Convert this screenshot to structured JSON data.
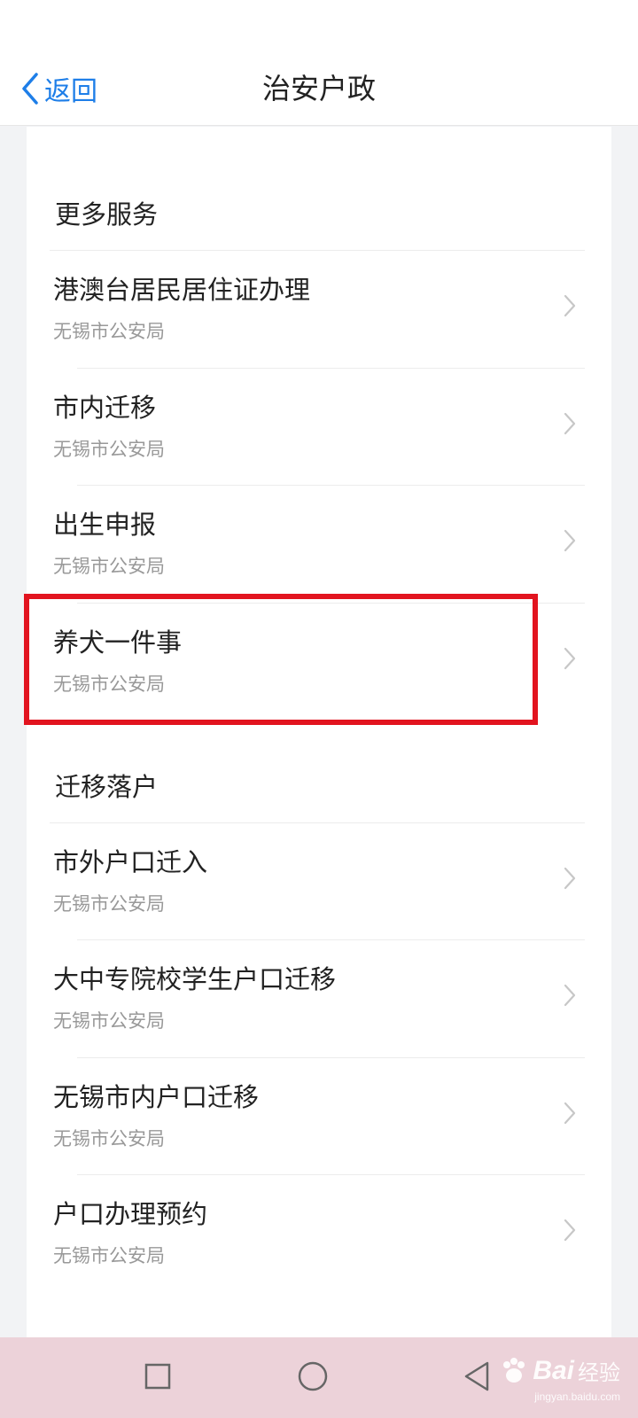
{
  "header": {
    "back_label": "返回",
    "title": "治安户政"
  },
  "sections": [
    {
      "title": "更多服务",
      "items": [
        {
          "title": "港澳台居民居住证办理",
          "subtitle": "无锡市公安局"
        },
        {
          "title": "市内迁移",
          "subtitle": "无锡市公安局"
        },
        {
          "title": "出生申报",
          "subtitle": "无锡市公安局"
        },
        {
          "title": "养犬一件事",
          "subtitle": "无锡市公安局"
        }
      ]
    },
    {
      "title": "迁移落户",
      "items": [
        {
          "title": "市外户口迁入",
          "subtitle": "无锡市公安局"
        },
        {
          "title": "大中专院校学生户口迁移",
          "subtitle": "无锡市公安局"
        },
        {
          "title": "无锡市内户口迁移",
          "subtitle": "无锡市公安局"
        },
        {
          "title": "户口办理预约",
          "subtitle": "无锡市公安局"
        }
      ]
    }
  ],
  "highlight": {
    "target": "养犬一件事",
    "color": "#e2141f"
  },
  "watermark": {
    "brand_text": "Bai",
    "brand_suffix": "经验",
    "url": "jingyan.baidu.com"
  },
  "colors": {
    "accent": "#1e7ee8",
    "bottom_bar": "#ecd2d9"
  },
  "icons": {
    "back": "chevron-left-icon",
    "row_arrow": "chevron-right-icon",
    "recents": "square-icon",
    "home": "circle-icon",
    "system_back": "triangle-back-icon"
  }
}
